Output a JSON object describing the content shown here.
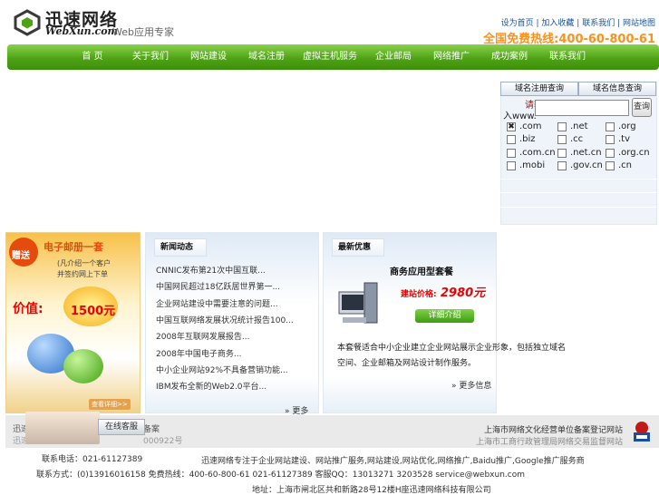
{
  "header": {
    "logo_cn": "迅速网络",
    "logo_en": "WebXun.com",
    "slogan": "Web应用专家",
    "top_links": [
      "设为首页",
      "加入收藏",
      "联系我们",
      "网站地图"
    ],
    "hotline": "全国免费热线:400-60-800-61"
  },
  "nav": {
    "items": [
      "首 页",
      "关于我们",
      "网站建设",
      "域名注册",
      "虚拟主机服务",
      "企业邮局",
      "网络推广",
      "成功案例",
      "联系我们"
    ]
  },
  "domain": {
    "tab_register": "域名注册查询",
    "tab_whois": "域名信息查询",
    "prefix_red": "请输",
    "prefix": "入www.",
    "input_value": "",
    "go_label": "查询",
    "tlds": [
      {
        "label": ".com",
        "checked": true
      },
      {
        "label": ".net",
        "checked": false
      },
      {
        "label": ".org",
        "checked": false
      },
      {
        "label": ".biz",
        "checked": false
      },
      {
        "label": ".cc",
        "checked": false
      },
      {
        "label": ".tv",
        "checked": false
      },
      {
        "label": ".com.cn",
        "checked": false
      },
      {
        "label": ".net.cn",
        "checked": false
      },
      {
        "label": ".org.cn",
        "checked": false
      },
      {
        "label": ".mobi",
        "checked": false
      },
      {
        "label": ".gov.cn",
        "checked": false
      },
      {
        "label": ".cn",
        "checked": false
      }
    ]
  },
  "promo": {
    "badge": "赠送",
    "title": "电子邮册一套",
    "sub1": "(凡介绍一个客户",
    "sub2": "并签约网上下单",
    "value_label": "价值:",
    "amount": "1500元",
    "more": "查看详细>>"
  },
  "news": {
    "tab": "新闻动态",
    "items": [
      "CNNIC发布第21次中国互联...",
      "中国网民超过18亿跃居世界第一...",
      "企业网站建设中需要注意的问题...",
      "中国互联网络发展状况统计报告100...",
      "2008年互联网发展报告...",
      "2008年中国电子商务...",
      "中小企业网站92%不具备营销功能...",
      "IBM发布全新的Web2.0平台..."
    ],
    "more": "更多"
  },
  "business": {
    "tab": "最新优惠",
    "title": "商务应用型套餐",
    "price_label": "建站价格:",
    "price": "2980元",
    "detail": "详细介绍",
    "desc1": "本套餐适合中小企业建立企业网站展示企业形象，包括独立域名",
    "desc2": "空间、企业邮箱及网站设计制作服务。",
    "more": "更多信息"
  },
  "band": {
    "left1": "迅速",
    "left2": "迅速",
    "left3": "备案",
    "left4": "000922号",
    "online_service": "在线客服",
    "right1": "上海市网络文化经营单位备案登记网站",
    "right2": "上海市工商行政管理局网络交易监督网站"
  },
  "footer": {
    "line1": "迅速网络专注于企业网站建设、网站推广服务,网站建设,网站优化,网络推广,Baidu推广,Google推广服务商",
    "phone1": "联系电话：021-61127389",
    "phone2": "联系方式：(0)13916016158 免费热线：400-60-800-61 021-61127389 客服QQ：13013271 3203528 service@webxun.com",
    "line3": "地址：上海市闸北区共和新路28号12楼H座迅速网络科技有限公司"
  }
}
